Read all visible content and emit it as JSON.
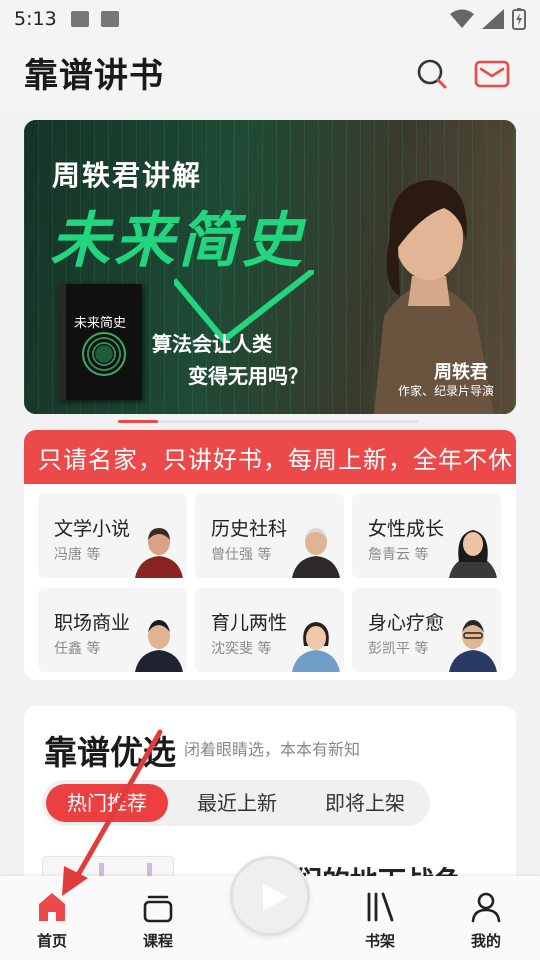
{
  "status_bar": {
    "time": "5:13"
  },
  "header": {
    "title": "靠谱讲书"
  },
  "banner": {
    "line1": "周轶君讲解",
    "line2": "未来简史",
    "line3": "算法会让人类",
    "line4": "变得无用吗？",
    "book_title": "未来简史",
    "speaker_name": "周轶君",
    "speaker_role": "作家、纪录片导演"
  },
  "slogan": "只请名家，只讲好书，每周上新，全年不休",
  "categories": [
    {
      "name": "文学小说",
      "sub": "冯唐 等"
    },
    {
      "name": "历史社科",
      "sub": "曾仕强 等"
    },
    {
      "name": "女性成长",
      "sub": "詹青云 等"
    },
    {
      "name": "职场商业",
      "sub": "任鑫 等"
    },
    {
      "name": "育儿两性",
      "sub": "沈奕斐 等"
    },
    {
      "name": "身心疗愈",
      "sub": "彭凯平 等"
    }
  ],
  "featured": {
    "title": "靠谱优选",
    "subtitle": "闭着眼睛选，本本有新知",
    "tabs": [
      "热门推荐",
      "最近上新",
      "即将上架"
    ],
    "peek_title": "女孩们的地下战争"
  },
  "bottom_nav": [
    {
      "label": "首页"
    },
    {
      "label": "课程"
    },
    {
      "label": "书架"
    },
    {
      "label": "我的"
    }
  ],
  "colors": {
    "accent": "#EC4A4A",
    "banner_green": "#21D67E"
  }
}
